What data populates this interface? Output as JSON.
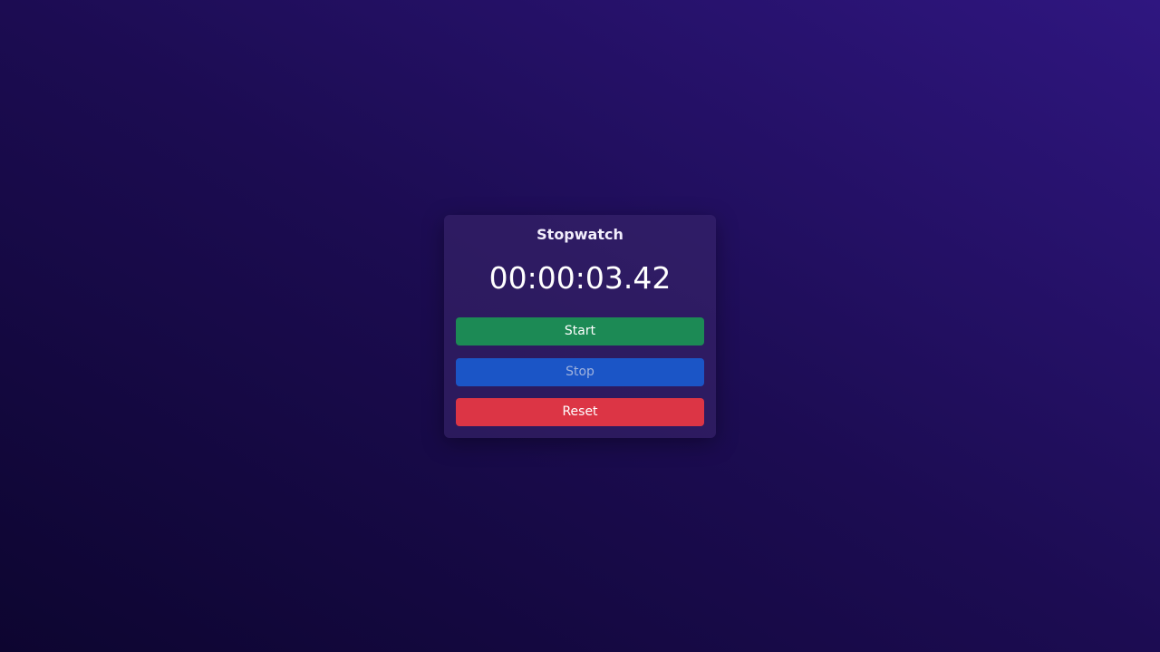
{
  "stopwatch": {
    "title": "Stopwatch",
    "time": "00:00:03.42",
    "buttons": {
      "start": "Start",
      "stop": "Stop",
      "reset": "Reset"
    }
  },
  "colors": {
    "start": "#1c8a55",
    "stop": "#1b55c6",
    "reset": "#dc3545"
  }
}
